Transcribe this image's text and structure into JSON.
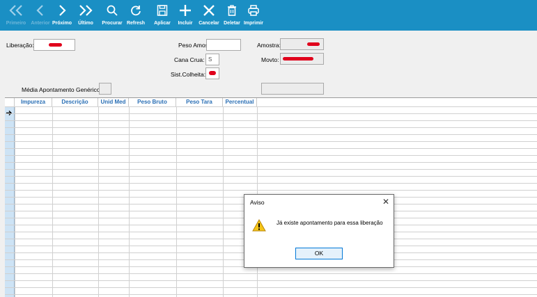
{
  "toolbar": {
    "first_label": "Primeiro",
    "prev_label": "Anterior",
    "next_label": "Próximo",
    "last_label": "Último",
    "search_label": "Procurar",
    "refresh_label": "Refresh",
    "apply_label": "Aplicar",
    "insert_label": "Incluir",
    "cancel_label": "Cancelar",
    "delete_label": "Deletar",
    "print_label": "Imprimir"
  },
  "form": {
    "liberacao_label": "Liberação:",
    "peso_amostra_label": "Peso Amostra:",
    "amostra_label": "Amostra:",
    "cana_crua_label": "Cana Crua:",
    "cana_crua_value": "S",
    "movto_label": "Movto:",
    "sist_colheita_label": "Sist.Colheita:",
    "media_label": "Média Apontamento Genérico:"
  },
  "grid": {
    "columns": [
      "Impureza",
      "Descrição",
      "Unid Med",
      "Peso Bruto",
      "Peso Tara",
      "Percentual"
    ]
  },
  "dialog": {
    "title": "Aviso",
    "close": "✕",
    "message": "Já existe apontamento para essa liberação",
    "ok_label": "OK"
  },
  "colors": {
    "toolbar": "#1a8fc4",
    "header_text": "#2a6fb5",
    "redaction": "#e0001c"
  }
}
